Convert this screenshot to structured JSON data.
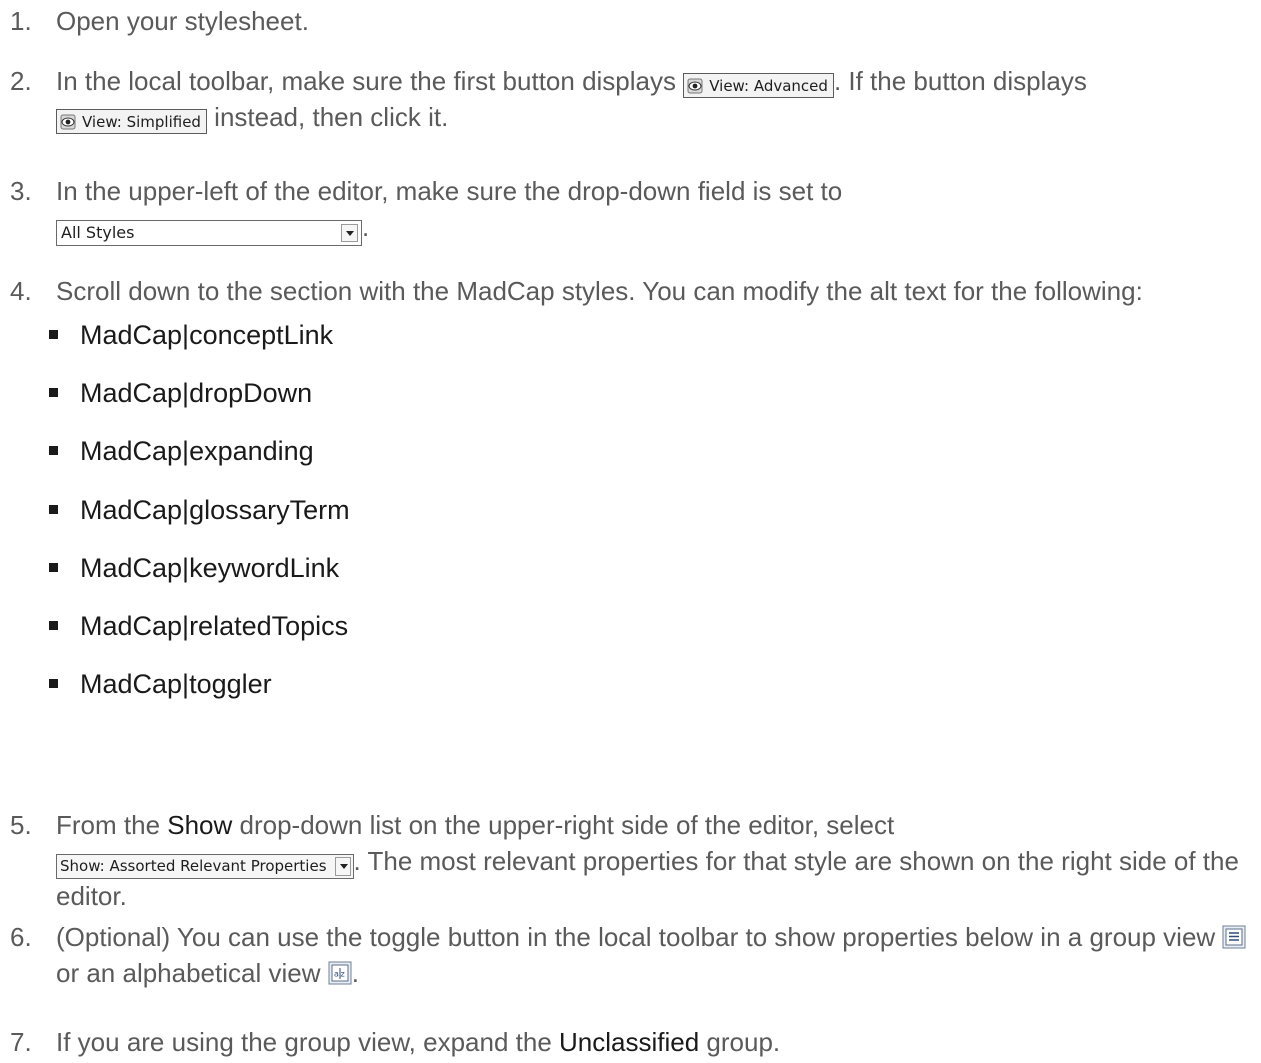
{
  "steps": [
    {
      "num": "1.",
      "text": "Open your stylesheet."
    },
    {
      "num": "2.",
      "a": "In the local toolbar, make sure the first button displays ",
      "btn1": "View: Advanced",
      "b": ". If the button displays ",
      "btn2": "View: Simplified",
      "c": " instead, then click it."
    },
    {
      "num": "3.",
      "a": "In the upper-left of the editor, make sure the drop-down field is set to ",
      "select": "All Styles",
      "c": "."
    },
    {
      "num": "4.",
      "a": "Scroll down to the section with the MadCap styles. You can modify the alt text for the following:",
      "items": [
        "MadCap|conceptLink",
        "MadCap|dropDown",
        "MadCap|expanding",
        "MadCap|glossaryTerm",
        "MadCap|keywordLink",
        "MadCap|relatedTopics",
        "MadCap|toggler"
      ]
    },
    {
      "num": "5.",
      "a": "From the ",
      "strong": "Show",
      "b": " drop-down list on the upper-right side of the editor, select ",
      "show": "Show: Assorted Relevant Properties",
      "c": ". The most relevant properties for that style are shown on the right side of the editor."
    },
    {
      "num": "6.",
      "a": "(Optional) You can use the toggle button in the local toolbar to show properties below in a group view ",
      "b": " or an alphabetical view ",
      "c": "."
    },
    {
      "num": "7.",
      "a": "If you are using the group view, expand the ",
      "strong": "Unclassified",
      "b": " group."
    }
  ],
  "icons": {
    "view_button": "eye-icon",
    "group_view": "group-view-icon",
    "alpha_view": "alphabetical-view-icon"
  }
}
